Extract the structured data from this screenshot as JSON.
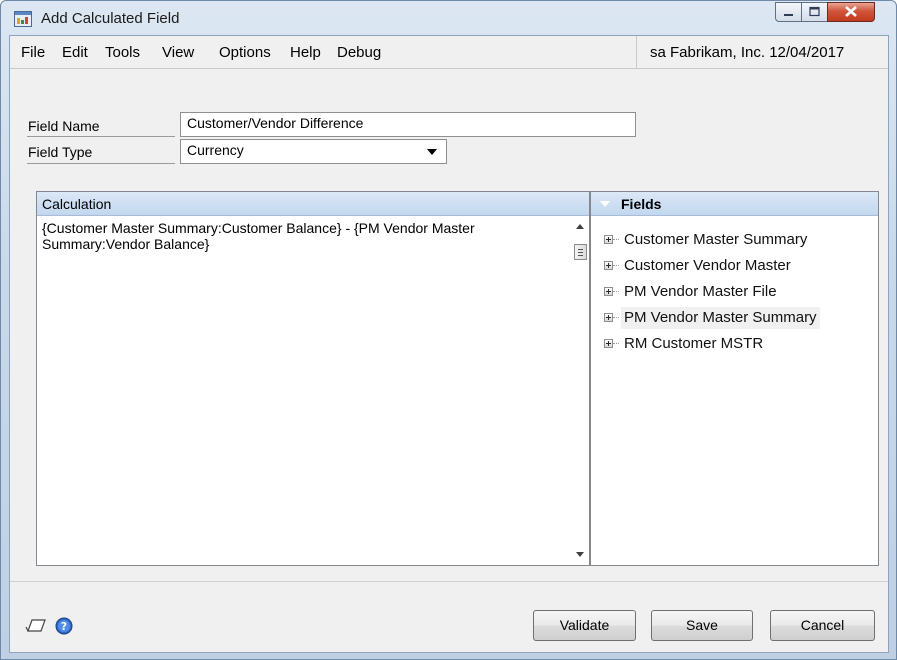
{
  "window": {
    "title": "Add Calculated Field"
  },
  "menu": {
    "items": [
      "File",
      "Edit",
      "Tools",
      "View",
      "Options",
      "Help",
      "Debug"
    ],
    "user_info": "sa  Fabrikam, Inc.  12/04/2017"
  },
  "form": {
    "field_name_label": "Field Name",
    "field_name_value": "Customer/Vendor Difference",
    "field_type_label": "Field Type",
    "field_type_value": "Currency"
  },
  "calculation": {
    "header": "Calculation",
    "text": "{Customer Master Summary:Customer Balance} - {PM Vendor Master Summary:Vendor Balance}"
  },
  "fields": {
    "header": "Fields",
    "items": [
      {
        "label": "Customer Master Summary"
      },
      {
        "label": "Customer Vendor Master"
      },
      {
        "label": "PM Vendor Master File"
      },
      {
        "label": "PM Vendor Master Summary"
      },
      {
        "label": "RM Customer MSTR"
      }
    ]
  },
  "buttons": {
    "validate": "Validate",
    "save": "Save",
    "cancel": "Cancel"
  },
  "icons": {
    "app": "calculator-window-icon",
    "note": "note-icon",
    "help": "help-icon"
  },
  "colors": {
    "header_blue": "#c2d7ee",
    "fields_header_blue": "#8fb1dd"
  }
}
